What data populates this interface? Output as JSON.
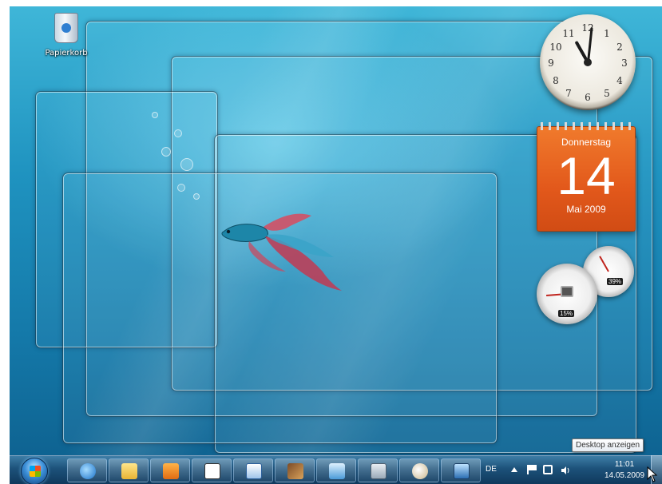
{
  "desktop": {
    "icons": [
      {
        "label": "Papierkorb",
        "icon": "recycle-bin-icon"
      }
    ]
  },
  "gadgets": {
    "clock": {
      "hours_display": [
        "12",
        "1",
        "2",
        "3",
        "4",
        "5",
        "6",
        "7",
        "8",
        "9",
        "10",
        "11"
      ],
      "hour": 11,
      "minute": 1
    },
    "calendar": {
      "weekday": "Donnerstag",
      "day": "14",
      "month": "Mai 2009",
      "color": "#e2581b"
    },
    "cpu_meter": {
      "cpu_label": "15%",
      "memory_label": "39%",
      "cpu": 0.15,
      "memory": 0.39
    }
  },
  "taskbar": {
    "start": {
      "icon": "windows-start-orb-icon"
    },
    "pinned": [
      {
        "name": "internet-explorer",
        "icon": "internet-explorer-icon"
      },
      {
        "name": "windows-explorer",
        "icon": "folder-icon"
      },
      {
        "name": "media-player",
        "icon": "media-player-icon"
      },
      {
        "name": "solitaire",
        "icon": "solitaire-cards-icon"
      },
      {
        "name": "wordpad",
        "icon": "wordpad-icon"
      },
      {
        "name": "games",
        "icon": "games-icon"
      },
      {
        "name": "control-panel",
        "icon": "control-panel-icon"
      },
      {
        "name": "calculator",
        "icon": "calculator-icon"
      },
      {
        "name": "paint",
        "icon": "paint-palette-icon"
      },
      {
        "name": "remote-desktop",
        "icon": "remote-desktop-icon"
      }
    ],
    "tray": {
      "language": "DE",
      "time": "11:01",
      "date": "14.05.2009"
    },
    "show_desktop_tooltip": "Desktop anzeigen"
  }
}
